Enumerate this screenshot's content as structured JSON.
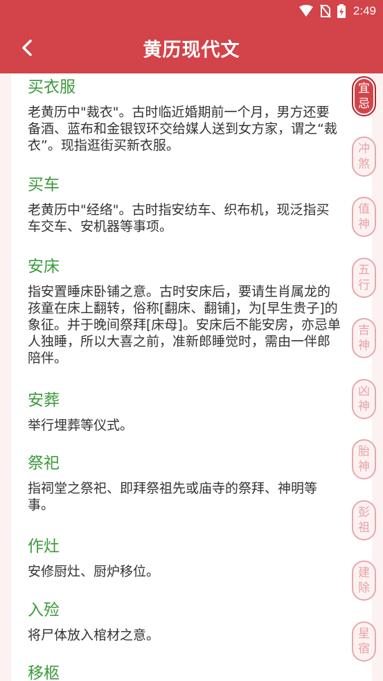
{
  "status_bar": {
    "time": "2:49"
  },
  "header": {
    "title": "黄历现代文"
  },
  "entries": [
    {
      "title": "买衣服",
      "desc": "老黄历中\"裁衣\"。古时临近婚期前一个月，男方还要备酒、蓝布和金银钗环交给媒人送到女方家，谓之“裁衣”。现指逛街买新衣服。"
    },
    {
      "title": "买车",
      "desc": "老黄历中\"经络\"。古时指安纺车、织布机，现泛指买车交车、安机器等事项。"
    },
    {
      "title": "安床",
      "desc": "指安置睡床卧铺之意。古时安床后，要请生肖属龙的孩童在床上翻转，俗称[翻床、翻铺]，为[早生贵子]的象征。并于晚间祭拜[床母]。安床后不能安房，亦忌单人独睡，所以大喜之前，准新郎睡觉时，需由一伴郎陪伴。"
    },
    {
      "title": "安葬",
      "desc": "举行埋葬等仪式。"
    },
    {
      "title": "祭祀",
      "desc": "指祠堂之祭祀、即拜祭祖先或庙寺的祭拜、神明等事。"
    },
    {
      "title": "作灶",
      "desc": "安修厨灶、厨炉移位。"
    },
    {
      "title": "入殓",
      "desc": "将尸体放入棺材之意。"
    },
    {
      "title": "移柩",
      "desc": ""
    }
  ],
  "side_nav": [
    {
      "top": "宜",
      "bottom": "忌",
      "active": true
    },
    {
      "top": "冲",
      "bottom": "煞",
      "active": false
    },
    {
      "top": "值",
      "bottom": "神",
      "active": false
    },
    {
      "top": "五",
      "bottom": "行",
      "active": false
    },
    {
      "top": "吉",
      "bottom": "神",
      "active": false
    },
    {
      "top": "凶",
      "bottom": "神",
      "active": false
    },
    {
      "top": "胎",
      "bottom": "神",
      "active": false
    },
    {
      "top": "彭",
      "bottom": "祖",
      "active": false
    },
    {
      "top": "建",
      "bottom": "除",
      "active": false
    },
    {
      "top": "星",
      "bottom": "宿",
      "active": false
    }
  ],
  "colors": {
    "primary": "#d24449",
    "entry_title": "#3a9a3a",
    "body_text": "#333333",
    "side_inactive": "#e6a3a6",
    "background": "#fdf2f2"
  }
}
